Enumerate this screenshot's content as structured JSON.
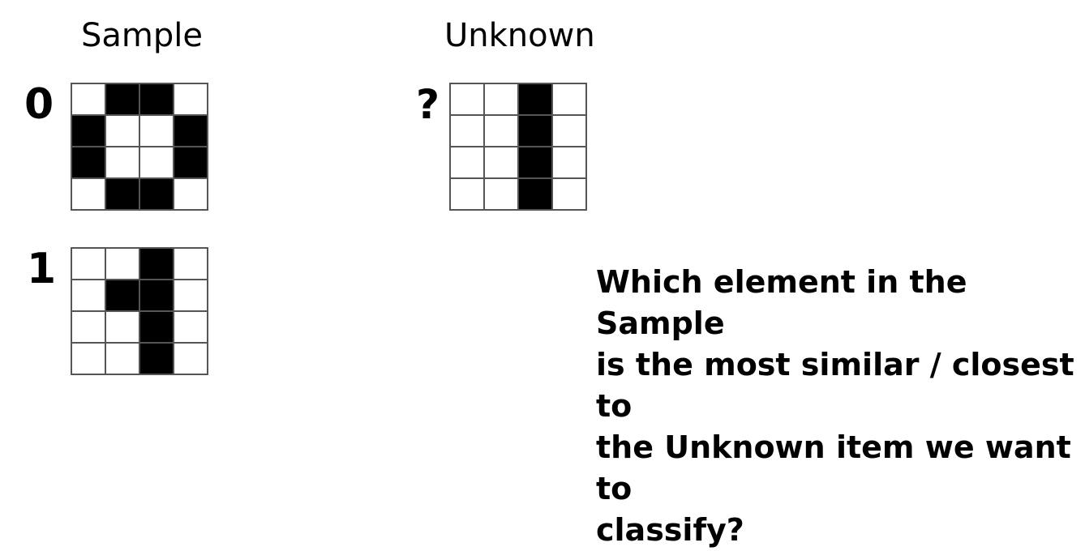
{
  "headings": {
    "sample": "Sample",
    "unknown": "Unknown"
  },
  "samples": [
    {
      "label": "0",
      "pattern": [
        [
          0,
          1,
          1,
          0
        ],
        [
          1,
          0,
          0,
          1
        ],
        [
          1,
          0,
          0,
          1
        ],
        [
          0,
          1,
          1,
          0
        ]
      ]
    },
    {
      "label": "1",
      "pattern": [
        [
          0,
          0,
          1,
          0
        ],
        [
          0,
          1,
          1,
          0
        ],
        [
          0,
          0,
          1,
          0
        ],
        [
          0,
          0,
          1,
          0
        ]
      ]
    }
  ],
  "unknown": {
    "label": "?",
    "pattern": [
      [
        0,
        0,
        1,
        0
      ],
      [
        0,
        0,
        1,
        0
      ],
      [
        0,
        0,
        1,
        0
      ],
      [
        0,
        0,
        1,
        0
      ]
    ]
  },
  "question": "Which element in the Sample\nis the most similar / closest to\nthe Unknown item we want to\nclassify?",
  "colors": {
    "filled": "#000000",
    "empty": "#ffffff",
    "grid_line": "#555555"
  }
}
